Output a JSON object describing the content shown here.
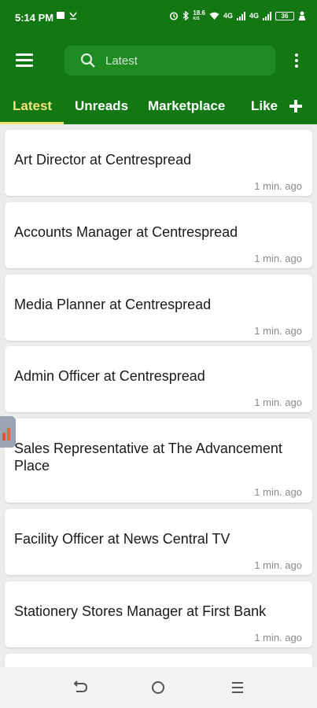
{
  "status_bar": {
    "time": "5:14 PM",
    "speed_value": "18.6",
    "speed_unit": "K/S",
    "network_1": "4G",
    "network_2": "4G",
    "battery": "36",
    "icons": [
      "message-icon",
      "download-icon",
      "alarm-icon",
      "bluetooth-icon",
      "wifi-icon",
      "signal-icon",
      "battery-icon",
      "person-icon"
    ]
  },
  "app_bar": {
    "search_placeholder": "Latest",
    "tabs": [
      {
        "label": "Latest",
        "active": true
      },
      {
        "label": "Unreads",
        "active": false
      },
      {
        "label": "Marketplace",
        "active": false
      },
      {
        "label": "Like",
        "active": false
      }
    ],
    "colors": {
      "primary": "#137813",
      "search_bg": "#1f8a22",
      "active_tab": "#f2e47a"
    }
  },
  "posts": [
    {
      "title": "Art Director at Centrespread",
      "time": "1 min. ago"
    },
    {
      "title": "Accounts Manager at Centrespread",
      "time": "1 min. ago"
    },
    {
      "title": "Media Planner at Centrespread",
      "time": "1 min. ago"
    },
    {
      "title": "Admin Officer at Centrespread",
      "time": "1 min. ago"
    },
    {
      "title": "Sales Representative at The Advancement Place",
      "time": "1 min. ago"
    },
    {
      "title": "Facility Officer at News Central TV",
      "time": "1 min. ago"
    },
    {
      "title": "Stationery Stores Manager at First Bank",
      "time": "1 min. ago"
    }
  ],
  "nav_bar": {
    "icons": [
      "back-icon",
      "home-icon",
      "recents-icon"
    ]
  }
}
